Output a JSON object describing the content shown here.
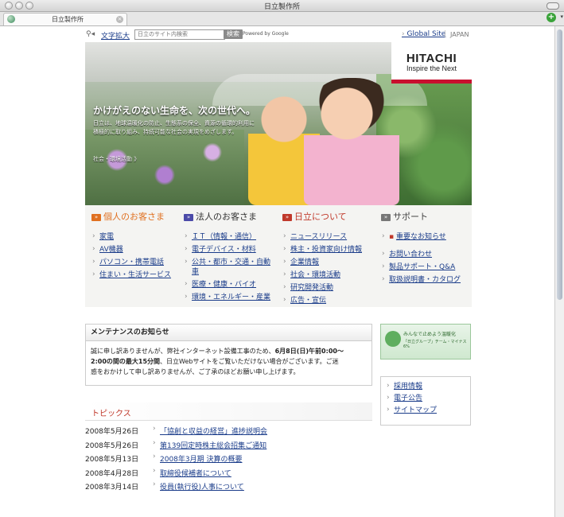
{
  "window": {
    "title": "日立製作所"
  },
  "tab": {
    "label": "日立製作所"
  },
  "util": {
    "text_size": "文字拡大",
    "search_placeholder": "日立のサイト内検索",
    "search_button": "検索",
    "powered": "Powered by Google",
    "global_site": "Global Site",
    "japan": "JAPAN"
  },
  "hero": {
    "headline": "かけがえのない生命を、次の世代へ。",
    "body": "日立は、地球温暖化の防止、生態系の保全、資源の循環的利用に積極的に取り組み、持続可能な社会の実現をめざします。",
    "link": "社会・環境活動 》"
  },
  "logo": {
    "word": "HITACHI",
    "tagline": "Inspire the Next"
  },
  "columns": [
    {
      "title": "個人のお客さま",
      "color": "#e07020",
      "items": [
        "家電",
        "AV機器",
        "パソコン・携帯電話",
        "住まい・生活サービス"
      ]
    },
    {
      "title": "法人のお客さま",
      "color": "#4b4aa8",
      "items": [
        "ＩＴ（情報・通信）",
        "電子デバイス・材料",
        "公共・都市・交通・自動車",
        "医療・健康・バイオ",
        "環境・エネルギー・産業"
      ]
    },
    {
      "title": "日立について",
      "color": "#c0392b",
      "items": [
        "ニュースリリース",
        "株主・投資家向け情報",
        "企業情報",
        "社会・環境活動",
        "研究開発活動",
        "広告・宣伝"
      ]
    },
    {
      "title": "サポート",
      "color": "#777777",
      "items": [
        "重要なお知らせ",
        "お問い合わせ",
        "製品サポート・Q&A",
        "取扱説明書・カタログ"
      ]
    }
  ],
  "maintenance": {
    "title": "メンテナンスのお知らせ",
    "line1_a": "誠に申し訳ありませんが、弊社インターネット設備工事のため、",
    "line1_b": "6月8日(日)午前0:00〜",
    "line2_a": "2:00の間の最大15分間",
    "line2_b": "、日立Webサイトをご覧いただけない場合がございます。ご迷",
    "line3": "惑をおかけして申し訳ありませんが、ご了承のほどお願い申し上げます。"
  },
  "banner": {
    "title": "みんなで止めよう温暖化",
    "sub": "「日立グループ」チーム・マイナス6%"
  },
  "side_links": [
    "採用情報",
    "電子公告",
    "サイトマップ"
  ],
  "topics": {
    "title": "トピックス",
    "items": [
      {
        "date": "2008年5月26日",
        "text": "「協創と収益の経営」進捗説明会"
      },
      {
        "date": "2008年5月26日",
        "text": "第139回定時株主総会招集ご通知"
      },
      {
        "date": "2008年5月13日",
        "text": "2008年3月期 決算の概要"
      },
      {
        "date": "2008年4月28日",
        "text": "取締役候補者について"
      },
      {
        "date": "2008年3月14日",
        "text": "役員(執行役)人事について"
      }
    ]
  }
}
